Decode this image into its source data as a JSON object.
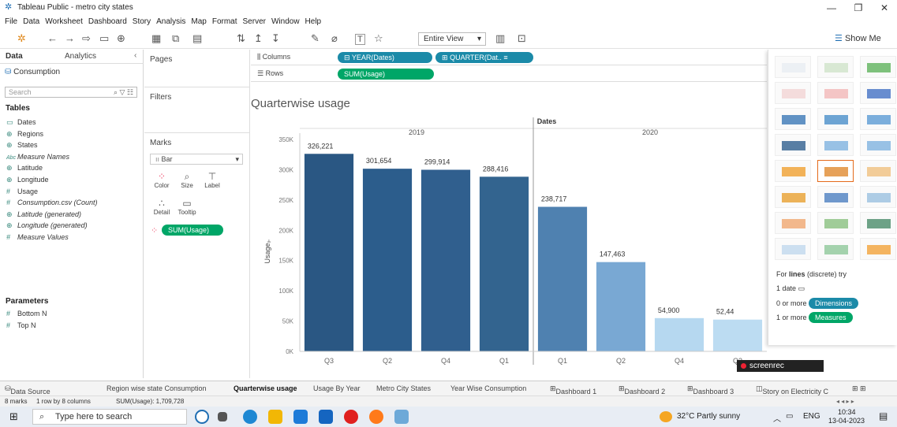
{
  "window": {
    "title": "Tableau Public - metro city states"
  },
  "menu": [
    "File",
    "Data",
    "Worksheet",
    "Dashboard",
    "Story",
    "Analysis",
    "Map",
    "Format",
    "Server",
    "Window",
    "Help"
  ],
  "toolbar": {
    "fit_label": "Entire View",
    "show_me": "Show Me"
  },
  "left": {
    "tab_data": "Data",
    "tab_analytics": "Analytics",
    "datasource": "Consumption",
    "search_placeholder": "Search",
    "tables_label": "Tables",
    "fields": [
      {
        "icon": "calendar",
        "name": "Dates",
        "italic": false
      },
      {
        "icon": "globe",
        "name": "Regions",
        "italic": false
      },
      {
        "icon": "globe",
        "name": "States",
        "italic": false
      },
      {
        "icon": "abc",
        "name": "Measure Names",
        "italic": true
      },
      {
        "icon": "globe",
        "name": "Latitude",
        "italic": false
      },
      {
        "icon": "globe",
        "name": "Longitude",
        "italic": false
      },
      {
        "icon": "hash",
        "name": "Usage",
        "italic": false
      },
      {
        "icon": "hash",
        "name": "Consumption.csv (Count)",
        "italic": true
      },
      {
        "icon": "globe",
        "name": "Latitude (generated)",
        "italic": true
      },
      {
        "icon": "globe",
        "name": "Longitude (generated)",
        "italic": true
      },
      {
        "icon": "hash",
        "name": "Measure Values",
        "italic": true
      }
    ],
    "parameters_label": "Parameters",
    "parameters": [
      "Bottom N",
      "Top N"
    ]
  },
  "cards": {
    "pages": "Pages",
    "filters": "Filters",
    "marks": "Marks",
    "mark_type": "Bar",
    "mark_buttons": [
      "Color",
      "Size",
      "Label",
      "Detail",
      "Tooltip"
    ],
    "mark_pill": "SUM(Usage)"
  },
  "shelves": {
    "columns_label": "Columns",
    "rows_label": "Rows",
    "columns_pills": [
      "YEAR(Dates)",
      "QUARTER(Dat.."
    ],
    "rows_pill": "SUM(Usage)"
  },
  "chart_data": {
    "type": "bar",
    "title": "Quarterwise usage",
    "header": "Dates",
    "ylabel": "Usage",
    "ylim": [
      0,
      350000
    ],
    "yticks": [
      "0K",
      "50K",
      "100K",
      "150K",
      "200K",
      "250K",
      "300K",
      "350K"
    ],
    "ytick_values": [
      0,
      50000,
      100000,
      150000,
      200000,
      250000,
      300000,
      350000
    ],
    "groups": [
      {
        "year": "2019",
        "categories": [
          "Q3",
          "Q2",
          "Q4",
          "Q1"
        ]
      },
      {
        "year": "2020",
        "categories": [
          "Q1",
          "Q2",
          "Q4",
          "Q3"
        ]
      }
    ],
    "values": [
      326221,
      301654,
      299914,
      288416,
      238717,
      147463,
      54900,
      52444
    ],
    "labels": [
      "326,221",
      "301,654",
      "299,914",
      "288,416",
      "238,717",
      "147,463",
      "54,900",
      "52,44"
    ],
    "colors": [
      "#2a5783",
      "#2c5d8c",
      "#305f8e",
      "#33648f",
      "#4f81b0",
      "#79a8d3",
      "#b6d8f0",
      "#bcdcf2"
    ]
  },
  "showme": {
    "hint_prefix": "For ",
    "hint_bold": "lines",
    "hint_suffix": " (discrete) try",
    "line1": "1 date",
    "line2": "0 or more",
    "dimensions": "Dimensions",
    "line3": "1 or more",
    "measures": "Measures"
  },
  "recorder": "screenrec",
  "sheets": [
    "Data Source",
    "Region wise state Consumption",
    "Quarterwise usage",
    "Usage By Year",
    "Metro City States",
    "Year Wise Consumption",
    "Dashboard 1",
    "Dashboard 2",
    "Dashboard 3",
    "Story on Electricity C"
  ],
  "active_sheet": "Quarterwise usage",
  "status": {
    "marks": "8 marks",
    "rows": "1 row by 8 columns",
    "sum": "SUM(Usage): 1,709,728"
  },
  "taskbar": {
    "search": "Type here to search",
    "weather": "32°C  Partly sunny",
    "lang": "ENG",
    "time": "10:34",
    "date": "13-04-2023"
  }
}
